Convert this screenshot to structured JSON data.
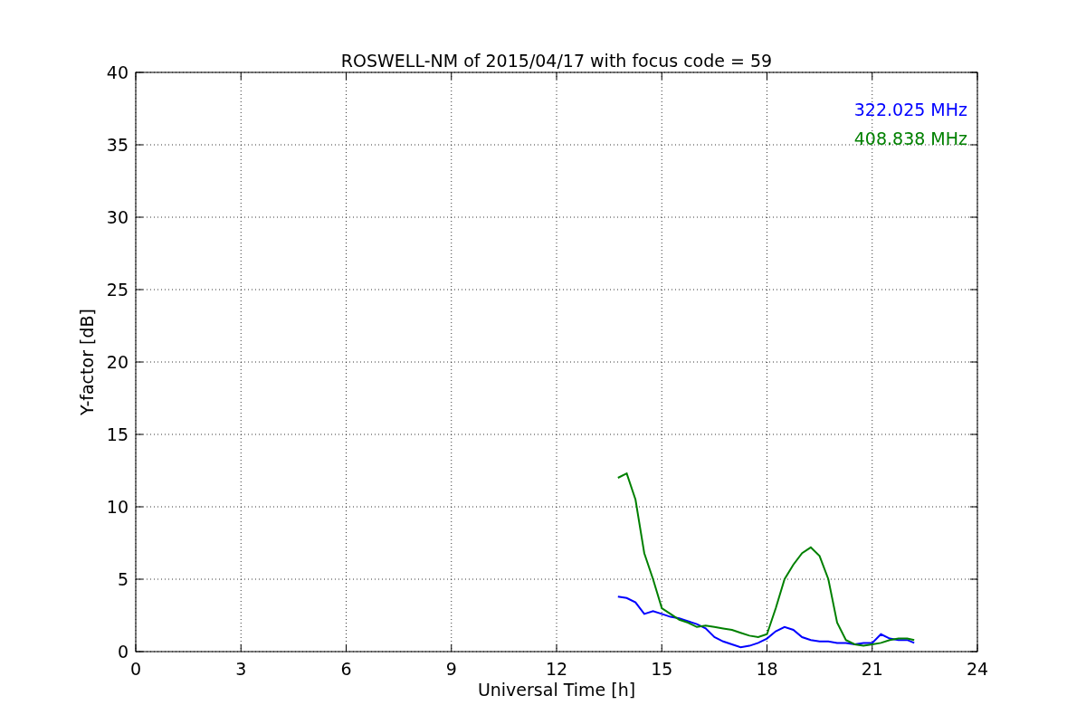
{
  "chart_data": {
    "type": "line",
    "title": "ROSWELL-NM of 2015/04/17 with focus code = 59",
    "xlabel": "Universal Time [h]",
    "ylabel": "Y-factor [dB]",
    "x": [
      13.75,
      14.0,
      14.25,
      14.5,
      14.75,
      15.0,
      15.25,
      15.5,
      15.75,
      16.0,
      16.25,
      16.5,
      16.75,
      17.0,
      17.25,
      17.5,
      17.75,
      18.0,
      18.25,
      18.5,
      18.75,
      19.0,
      19.25,
      19.5,
      19.75,
      20.0,
      20.25,
      20.5,
      20.75,
      21.0,
      21.25,
      21.5,
      21.75,
      22.0,
      22.2
    ],
    "series": [
      {
        "name": "322.025 MHz",
        "color": "#0000ff",
        "values": [
          3.8,
          3.7,
          3.4,
          2.6,
          2.8,
          2.6,
          2.4,
          2.3,
          2.1,
          1.9,
          1.6,
          1.0,
          0.7,
          0.5,
          0.3,
          0.4,
          0.6,
          0.9,
          1.4,
          1.7,
          1.5,
          1.0,
          0.8,
          0.7,
          0.7,
          0.6,
          0.6,
          0.5,
          0.6,
          0.6,
          1.2,
          0.9,
          0.8,
          0.8,
          0.6
        ]
      },
      {
        "name": "408.838 MHz",
        "color": "#008000",
        "values": [
          12.0,
          12.3,
          10.5,
          6.8,
          5.0,
          3.0,
          2.6,
          2.2,
          2.0,
          1.7,
          1.8,
          1.7,
          1.6,
          1.5,
          1.3,
          1.1,
          1.0,
          1.2,
          3.0,
          5.0,
          6.0,
          6.8,
          7.2,
          6.6,
          5.0,
          2.0,
          0.8,
          0.5,
          0.4,
          0.5,
          0.6,
          0.8,
          0.9,
          0.9,
          0.8
        ]
      }
    ],
    "grid": true,
    "xlim": [
      0,
      24
    ],
    "ylim": [
      0,
      40
    ],
    "xticks": [
      0,
      3,
      6,
      9,
      12,
      15,
      18,
      21,
      24
    ],
    "yticks": [
      0,
      5,
      10,
      15,
      20,
      25,
      30,
      35,
      40
    ]
  }
}
